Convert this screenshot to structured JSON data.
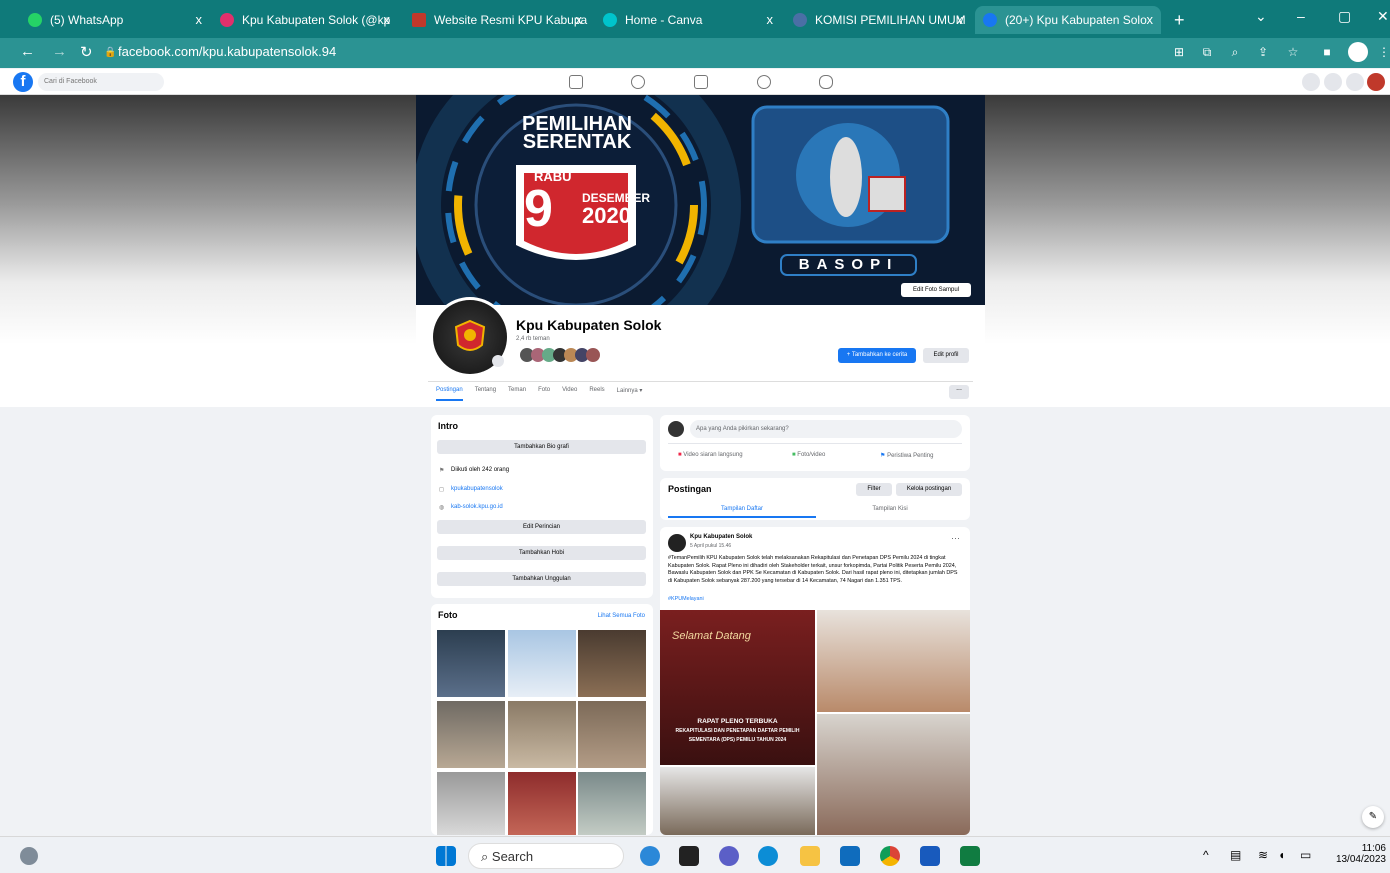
{
  "browser": {
    "tabs": [
      {
        "label": "(5) WhatsApp",
        "color": "#25d366",
        "active": false
      },
      {
        "label": "Kpu Kabupaten Solok (@kp",
        "color": "#e1306c",
        "active": false
      },
      {
        "label": "Website Resmi KPU Kabupa",
        "color": "#c0392b",
        "active": false
      },
      {
        "label": "Home - Canva",
        "color": "#00c4cc",
        "active": false
      },
      {
        "label": "KOMISI PEMILIHAN UMUM",
        "color": "#4a6fa5",
        "active": false
      },
      {
        "label": "(20+) Kpu Kabupaten Solo",
        "color": "#1877f2",
        "active": true
      }
    ],
    "new_tab": "+",
    "url": "facebook.com/kpu.kabupatensolok.94",
    "close_glyph": "x"
  },
  "fb": {
    "logo": "f",
    "search_placeholder": "Cari di Facebook"
  },
  "cover": {
    "headline1": "PEMILIHAN",
    "headline2": "SERENTAK",
    "day": "RABU",
    "date_num": "9",
    "month": "DESEMBER",
    "year": "2020",
    "mascot_label": "BASOPI",
    "edit_cover": "Edit Foto Sampul"
  },
  "profile": {
    "name": "Kpu Kabupaten Solok",
    "friends": "2,4 rb teman",
    "add_story": "+ Tambahkan ke cerita",
    "edit_profile": "Edit profil",
    "more": "..."
  },
  "tabs": [
    "Postingan",
    "Tentang",
    "Teman",
    "Foto",
    "Video",
    "Reels",
    "Lainnya ▾"
  ],
  "intro": {
    "title": "Intro",
    "add_bio": "Tambahkan Bio grafi",
    "followers": "Diikuti oleh 242 orang",
    "instagram": "kpukabupatensolok",
    "website": "kab-solok.kpu.go.id",
    "edit_details": "Edit Perincian",
    "add_hobby": "Tambahkan Hobi",
    "add_featured": "Tambahkan Unggulan"
  },
  "photos": {
    "title": "Foto",
    "see_all": "Lihat Semua Foto"
  },
  "composer": {
    "placeholder": "Apa yang Anda pikirkan sekarang?",
    "live": "Video siaran langsung",
    "photo": "Foto/video",
    "life_event": "Peristiwa Penting"
  },
  "posts": {
    "title": "Postingan",
    "filter": "Filter",
    "manage": "Kelola postingan",
    "list_view": "Tampilan Daftar",
    "grid_view": "Tampilan Kisi"
  },
  "post": {
    "author": "Kpu Kabupaten Solok",
    "time": "5 April pukul 15.46",
    "text": "#TemanPemilih KPU Kabupaten Solok telah melaksanakan Rekapitulasi dan Penetapan DPS Pemilu 2024 di tingkat Kabupaten Solok. Rapat Pleno ini dihadiri oleh Stakeholder terkait, unsur forkopimda, Partai Politik Peserta Pemilu 2024, Bawaslu Kabupaten Solok dan PPK Se Kecamatan di Kabupaten Solok. Dari hasil rapat pleno ini, ditetapkan jumlah DPS di Kabupaten Solok sebanyak 287.200 yang tersebar di 14 Kecamatan, 74 Nagari dan 1.351 TPS.",
    "hashtag": "#KPUMelayani",
    "image_caption1": "RAPAT PLENO TERBUKA",
    "image_caption2": "REKAPITULASI DAN PENETAPAN DAFTAR PEMILIH",
    "image_caption3": "SEMENTARA (DPS) PEMILU TAHUN 2024",
    "image_banner": "Selamat Datang"
  },
  "taskbar": {
    "search": "Search",
    "time": "11:06",
    "date": "13/04/2023"
  }
}
